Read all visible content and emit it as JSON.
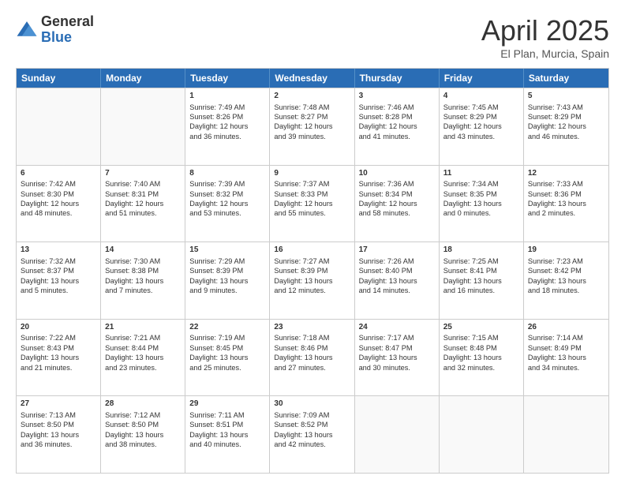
{
  "logo": {
    "general": "General",
    "blue": "Blue"
  },
  "header": {
    "title": "April 2025",
    "subtitle": "El Plan, Murcia, Spain"
  },
  "days": [
    "Sunday",
    "Monday",
    "Tuesday",
    "Wednesday",
    "Thursday",
    "Friday",
    "Saturday"
  ],
  "rows": [
    [
      {
        "day": "",
        "empty": true
      },
      {
        "day": "",
        "empty": true
      },
      {
        "day": "1",
        "line1": "Sunrise: 7:49 AM",
        "line2": "Sunset: 8:26 PM",
        "line3": "Daylight: 12 hours",
        "line4": "and 36 minutes."
      },
      {
        "day": "2",
        "line1": "Sunrise: 7:48 AM",
        "line2": "Sunset: 8:27 PM",
        "line3": "Daylight: 12 hours",
        "line4": "and 39 minutes."
      },
      {
        "day": "3",
        "line1": "Sunrise: 7:46 AM",
        "line2": "Sunset: 8:28 PM",
        "line3": "Daylight: 12 hours",
        "line4": "and 41 minutes."
      },
      {
        "day": "4",
        "line1": "Sunrise: 7:45 AM",
        "line2": "Sunset: 8:29 PM",
        "line3": "Daylight: 12 hours",
        "line4": "and 43 minutes."
      },
      {
        "day": "5",
        "line1": "Sunrise: 7:43 AM",
        "line2": "Sunset: 8:29 PM",
        "line3": "Daylight: 12 hours",
        "line4": "and 46 minutes."
      }
    ],
    [
      {
        "day": "6",
        "line1": "Sunrise: 7:42 AM",
        "line2": "Sunset: 8:30 PM",
        "line3": "Daylight: 12 hours",
        "line4": "and 48 minutes."
      },
      {
        "day": "7",
        "line1": "Sunrise: 7:40 AM",
        "line2": "Sunset: 8:31 PM",
        "line3": "Daylight: 12 hours",
        "line4": "and 51 minutes."
      },
      {
        "day": "8",
        "line1": "Sunrise: 7:39 AM",
        "line2": "Sunset: 8:32 PM",
        "line3": "Daylight: 12 hours",
        "line4": "and 53 minutes."
      },
      {
        "day": "9",
        "line1": "Sunrise: 7:37 AM",
        "line2": "Sunset: 8:33 PM",
        "line3": "Daylight: 12 hours",
        "line4": "and 55 minutes."
      },
      {
        "day": "10",
        "line1": "Sunrise: 7:36 AM",
        "line2": "Sunset: 8:34 PM",
        "line3": "Daylight: 12 hours",
        "line4": "and 58 minutes."
      },
      {
        "day": "11",
        "line1": "Sunrise: 7:34 AM",
        "line2": "Sunset: 8:35 PM",
        "line3": "Daylight: 13 hours",
        "line4": "and 0 minutes."
      },
      {
        "day": "12",
        "line1": "Sunrise: 7:33 AM",
        "line2": "Sunset: 8:36 PM",
        "line3": "Daylight: 13 hours",
        "line4": "and 2 minutes."
      }
    ],
    [
      {
        "day": "13",
        "line1": "Sunrise: 7:32 AM",
        "line2": "Sunset: 8:37 PM",
        "line3": "Daylight: 13 hours",
        "line4": "and 5 minutes."
      },
      {
        "day": "14",
        "line1": "Sunrise: 7:30 AM",
        "line2": "Sunset: 8:38 PM",
        "line3": "Daylight: 13 hours",
        "line4": "and 7 minutes."
      },
      {
        "day": "15",
        "line1": "Sunrise: 7:29 AM",
        "line2": "Sunset: 8:39 PM",
        "line3": "Daylight: 13 hours",
        "line4": "and 9 minutes."
      },
      {
        "day": "16",
        "line1": "Sunrise: 7:27 AM",
        "line2": "Sunset: 8:39 PM",
        "line3": "Daylight: 13 hours",
        "line4": "and 12 minutes."
      },
      {
        "day": "17",
        "line1": "Sunrise: 7:26 AM",
        "line2": "Sunset: 8:40 PM",
        "line3": "Daylight: 13 hours",
        "line4": "and 14 minutes."
      },
      {
        "day": "18",
        "line1": "Sunrise: 7:25 AM",
        "line2": "Sunset: 8:41 PM",
        "line3": "Daylight: 13 hours",
        "line4": "and 16 minutes."
      },
      {
        "day": "19",
        "line1": "Sunrise: 7:23 AM",
        "line2": "Sunset: 8:42 PM",
        "line3": "Daylight: 13 hours",
        "line4": "and 18 minutes."
      }
    ],
    [
      {
        "day": "20",
        "line1": "Sunrise: 7:22 AM",
        "line2": "Sunset: 8:43 PM",
        "line3": "Daylight: 13 hours",
        "line4": "and 21 minutes."
      },
      {
        "day": "21",
        "line1": "Sunrise: 7:21 AM",
        "line2": "Sunset: 8:44 PM",
        "line3": "Daylight: 13 hours",
        "line4": "and 23 minutes."
      },
      {
        "day": "22",
        "line1": "Sunrise: 7:19 AM",
        "line2": "Sunset: 8:45 PM",
        "line3": "Daylight: 13 hours",
        "line4": "and 25 minutes."
      },
      {
        "day": "23",
        "line1": "Sunrise: 7:18 AM",
        "line2": "Sunset: 8:46 PM",
        "line3": "Daylight: 13 hours",
        "line4": "and 27 minutes."
      },
      {
        "day": "24",
        "line1": "Sunrise: 7:17 AM",
        "line2": "Sunset: 8:47 PM",
        "line3": "Daylight: 13 hours",
        "line4": "and 30 minutes."
      },
      {
        "day": "25",
        "line1": "Sunrise: 7:15 AM",
        "line2": "Sunset: 8:48 PM",
        "line3": "Daylight: 13 hours",
        "line4": "and 32 minutes."
      },
      {
        "day": "26",
        "line1": "Sunrise: 7:14 AM",
        "line2": "Sunset: 8:49 PM",
        "line3": "Daylight: 13 hours",
        "line4": "and 34 minutes."
      }
    ],
    [
      {
        "day": "27",
        "line1": "Sunrise: 7:13 AM",
        "line2": "Sunset: 8:50 PM",
        "line3": "Daylight: 13 hours",
        "line4": "and 36 minutes."
      },
      {
        "day": "28",
        "line1": "Sunrise: 7:12 AM",
        "line2": "Sunset: 8:50 PM",
        "line3": "Daylight: 13 hours",
        "line4": "and 38 minutes."
      },
      {
        "day": "29",
        "line1": "Sunrise: 7:11 AM",
        "line2": "Sunset: 8:51 PM",
        "line3": "Daylight: 13 hours",
        "line4": "and 40 minutes."
      },
      {
        "day": "30",
        "line1": "Sunrise: 7:09 AM",
        "line2": "Sunset: 8:52 PM",
        "line3": "Daylight: 13 hours",
        "line4": "and 42 minutes."
      },
      {
        "day": "",
        "empty": true
      },
      {
        "day": "",
        "empty": true
      },
      {
        "day": "",
        "empty": true
      }
    ]
  ]
}
